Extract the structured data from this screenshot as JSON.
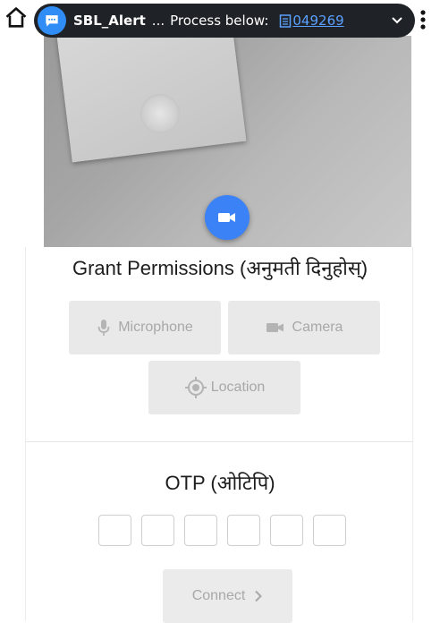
{
  "notification": {
    "title": "SBL_Alert",
    "separator": "...",
    "message": "Process below:",
    "code": "049269"
  },
  "icons": {
    "home": "home-icon",
    "chat": "chat-bubble-icon",
    "expand": "chevron-down-icon",
    "menu": "more-vert-icon",
    "video": "videocam-icon",
    "mic": "microphone-icon",
    "camera": "camera-icon",
    "location": "location-target-icon",
    "connect": "chevron-right-icon"
  },
  "colors": {
    "notification_bg": "#1f2226",
    "link": "#5aa0ff",
    "fab": "#3b82f6",
    "disabled_button": "#e9e9e9",
    "disabled_text": "#a8a8a8"
  },
  "permissions": {
    "heading": "Grant Permissions (अनुमती दिनुहोस्)",
    "microphone_label": "Microphone",
    "camera_label": "Camera",
    "location_label": "Location"
  },
  "otp": {
    "heading": "OTP (ओटिपि)",
    "digits": [
      "",
      "",
      "",
      "",
      "",
      ""
    ]
  },
  "connect": {
    "label": "Connect"
  }
}
